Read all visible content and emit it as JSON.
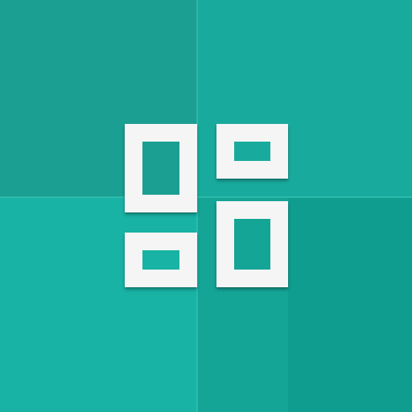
{
  "icon": {
    "name": "grid-layout-app-icon",
    "colors": {
      "background_base": "#19a99b",
      "quadrant_top_left": "#1a9f92",
      "quadrant_top_right": "#18ab9d",
      "quadrant_bottom_left": "#18b3a5",
      "quadrant_bottom_right": "#14a597",
      "bottom_right_shade": "#0f9d8f",
      "divider": "#42c4b7",
      "frame": "#f5f5f5"
    },
    "tiles": [
      {
        "name": "tile-tall-top-left",
        "shape": "tall-rectangle"
      },
      {
        "name": "tile-wide-top-right",
        "shape": "wide-rectangle"
      },
      {
        "name": "tile-wide-bottom-left",
        "shape": "wide-rectangle"
      },
      {
        "name": "tile-tall-bottom-right",
        "shape": "tall-rectangle"
      }
    ]
  }
}
